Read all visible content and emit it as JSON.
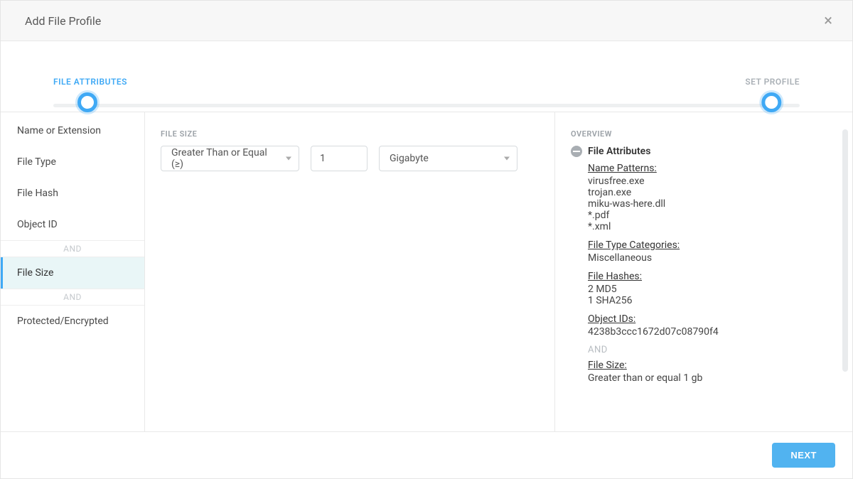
{
  "modal": {
    "title": "Add File Profile"
  },
  "stepper": {
    "steps": [
      {
        "label": "FILE ATTRIBUTES"
      },
      {
        "label": "SET PROFILE"
      }
    ]
  },
  "sidebar": {
    "items": [
      {
        "label": "Name or Extension"
      },
      {
        "label": "File Type"
      },
      {
        "label": "File Hash"
      },
      {
        "label": "Object ID"
      },
      {
        "label": "File Size"
      },
      {
        "label": "Protected/Encrypted"
      }
    ],
    "separator": "AND"
  },
  "main": {
    "section_label": "FILE SIZE",
    "comparator": "Greater Than or Equal (≥)",
    "value": "1",
    "unit": "Gigabyte"
  },
  "overview": {
    "title": "OVERVIEW",
    "section_title": "File Attributes",
    "name_patterns_title": "Name Patterns:",
    "name_patterns": [
      "virusfree.exe",
      "trojan.exe",
      "miku-was-here.dll",
      "*.pdf",
      "*.xml"
    ],
    "file_type_title": "File Type Categories:",
    "file_type_values": [
      "Miscellaneous"
    ],
    "file_hashes_title": "File Hashes:",
    "file_hashes": [
      "2 MD5",
      "1 SHA256"
    ],
    "object_ids_title": "Object IDs:",
    "object_ids": [
      "4238b3ccc1672d07c08790f4"
    ],
    "and": "AND",
    "file_size_title": "File Size:",
    "file_size_value": "Greater than or equal 1 gb"
  },
  "footer": {
    "next": "NEXT"
  }
}
